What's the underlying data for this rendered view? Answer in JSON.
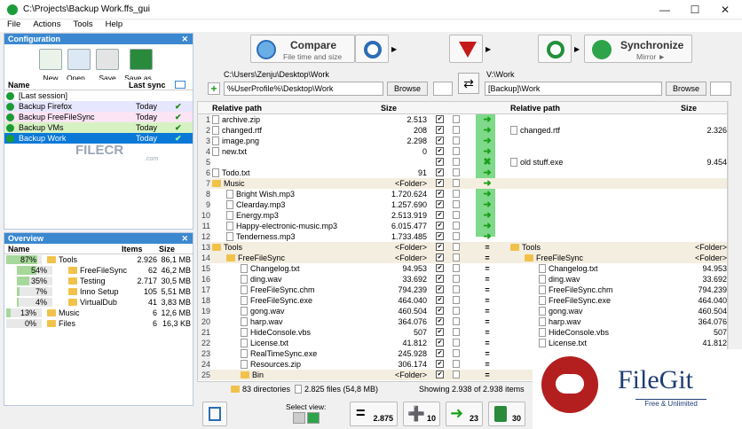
{
  "window": {
    "title": "C:\\Projects\\Backup Work.ffs_gui",
    "min": "—",
    "max": "☐",
    "close": "✕"
  },
  "menu": [
    "File",
    "Actions",
    "Tools",
    "Help"
  ],
  "config": {
    "title": "Configuration",
    "buttons": [
      "New",
      "Open...",
      "Save",
      "Save as..."
    ],
    "col_name": "Name",
    "col_sync": "Last sync",
    "sessions": [
      {
        "name": "[Last session]",
        "date": ""
      },
      {
        "name": "Backup Firefox",
        "date": "Today"
      },
      {
        "name": "Backup FreeFileSync",
        "date": "Today"
      },
      {
        "name": "Backup VMs",
        "date": "Today"
      },
      {
        "name": "Backup Work",
        "date": "Today"
      }
    ]
  },
  "overview": {
    "title": "Overview",
    "col_name": "Name",
    "col_items": "Items",
    "col_size": "Size",
    "rows": [
      {
        "pct": "87%",
        "pctv": 0.87,
        "name": "Tools",
        "items": "2.926",
        "size": "86,1 MB",
        "indent": 0
      },
      {
        "pct": "54%",
        "pctv": 0.54,
        "name": "FreeFileSync",
        "items": "62",
        "size": "46,2 MB",
        "indent": 1
      },
      {
        "pct": "35%",
        "pctv": 0.35,
        "name": "Testing",
        "items": "2.717",
        "size": "30,5 MB",
        "indent": 1
      },
      {
        "pct": "7%",
        "pctv": 0.07,
        "name": "Inno Setup",
        "items": "105",
        "size": "5,51 MB",
        "indent": 1
      },
      {
        "pct": "4%",
        "pctv": 0.04,
        "name": "VirtualDub",
        "items": "41",
        "size": "3,83 MB",
        "indent": 1
      },
      {
        "pct": "13%",
        "pctv": 0.13,
        "name": "Music",
        "items": "6",
        "size": "12,6 MB",
        "indent": 0
      },
      {
        "pct": "0%",
        "pctv": 0.0,
        "name": "Files",
        "items": "6",
        "size": "16,3 KB",
        "indent": 0
      }
    ]
  },
  "toolbar": {
    "compare": "Compare",
    "compare_sub": "File time and size",
    "sync": "Synchronize",
    "sync_sub": "Mirror ►"
  },
  "paths": {
    "left_label": "C:\\Users\\Zenju\\Desktop\\Work",
    "left_value": "%UserProfile%\\Desktop\\Work",
    "right_label": "V:\\Work",
    "right_value": "[Backup]\\Work",
    "browse": "Browse"
  },
  "grid": {
    "col_path": "Relative path",
    "col_size": "Size",
    "left_rows": [
      {
        "n": "1",
        "name": "archive.zip",
        "size": "2.513",
        "indent": 0,
        "folder": false,
        "act": "sync"
      },
      {
        "n": "2",
        "name": "changed.rtf",
        "size": "208",
        "indent": 0,
        "folder": false,
        "act": "sync"
      },
      {
        "n": "3",
        "name": "image.png",
        "size": "2.298",
        "indent": 0,
        "folder": false,
        "act": "sync"
      },
      {
        "n": "4",
        "name": "new.txt",
        "size": "0",
        "indent": 0,
        "folder": false,
        "act": "sync"
      },
      {
        "n": "5",
        "name": "",
        "size": "",
        "indent": 0,
        "folder": false,
        "act": "del"
      },
      {
        "n": "6",
        "name": "Todo.txt",
        "size": "91",
        "indent": 0,
        "folder": false,
        "act": "sync"
      },
      {
        "n": "7",
        "name": "Music",
        "size": "<Folder>",
        "indent": 0,
        "folder": true,
        "act": "sync"
      },
      {
        "n": "8",
        "name": "Bright Wish.mp3",
        "size": "1.720.624",
        "indent": 1,
        "folder": false,
        "act": "sync"
      },
      {
        "n": "9",
        "name": "Clearday.mp3",
        "size": "1.257.690",
        "indent": 1,
        "folder": false,
        "act": "sync"
      },
      {
        "n": "10",
        "name": "Energy.mp3",
        "size": "2.513.919",
        "indent": 1,
        "folder": false,
        "act": "sync"
      },
      {
        "n": "11",
        "name": "Happy-electronic-music.mp3",
        "size": "6.015.477",
        "indent": 1,
        "folder": false,
        "act": "sync"
      },
      {
        "n": "12",
        "name": "Tenderness.mp3",
        "size": "1.733.485",
        "indent": 1,
        "folder": false,
        "act": "sync"
      },
      {
        "n": "13",
        "name": "Tools",
        "size": "<Folder>",
        "indent": 0,
        "folder": true,
        "act": "eq"
      },
      {
        "n": "14",
        "name": "FreeFileSync",
        "size": "<Folder>",
        "indent": 1,
        "folder": true,
        "act": "eq"
      },
      {
        "n": "15",
        "name": "Changelog.txt",
        "size": "94.953",
        "indent": 2,
        "folder": false,
        "act": "eq"
      },
      {
        "n": "16",
        "name": "ding.wav",
        "size": "33.692",
        "indent": 2,
        "folder": false,
        "act": "eq"
      },
      {
        "n": "17",
        "name": "FreeFileSync.chm",
        "size": "794.239",
        "indent": 2,
        "folder": false,
        "act": "eq"
      },
      {
        "n": "18",
        "name": "FreeFileSync.exe",
        "size": "464.040",
        "indent": 2,
        "folder": false,
        "act": "eq"
      },
      {
        "n": "19",
        "name": "gong.wav",
        "size": "460.504",
        "indent": 2,
        "folder": false,
        "act": "eq"
      },
      {
        "n": "20",
        "name": "harp.wav",
        "size": "364.076",
        "indent": 2,
        "folder": false,
        "act": "eq"
      },
      {
        "n": "21",
        "name": "HideConsole.vbs",
        "size": "507",
        "indent": 2,
        "folder": false,
        "act": "eq"
      },
      {
        "n": "22",
        "name": "License.txt",
        "size": "41.812",
        "indent": 2,
        "folder": false,
        "act": "eq"
      },
      {
        "n": "23",
        "name": "RealTimeSync.exe",
        "size": "245.928",
        "indent": 2,
        "folder": false,
        "act": "eq"
      },
      {
        "n": "24",
        "name": "Resources.zip",
        "size": "306.174",
        "indent": 2,
        "folder": false,
        "act": "eq"
      },
      {
        "n": "25",
        "name": "Bin",
        "size": "<Folder>",
        "indent": 2,
        "folder": true,
        "act": "eq"
      }
    ],
    "right_rows": [
      {
        "name": "",
        "size": "",
        "indent": 0,
        "folder": false
      },
      {
        "name": "changed.rtf",
        "size": "2.326",
        "indent": 0,
        "folder": false
      },
      {
        "name": "",
        "size": "",
        "indent": 0,
        "folder": false
      },
      {
        "name": "",
        "size": "",
        "indent": 0,
        "folder": false
      },
      {
        "name": "old stuff.exe",
        "size": "9.454",
        "indent": 0,
        "folder": false
      },
      {
        "name": "",
        "size": "",
        "indent": 0,
        "folder": false
      },
      {
        "name": "",
        "size": "",
        "indent": 0,
        "folder": false
      },
      {
        "name": "",
        "size": "",
        "indent": 0,
        "folder": false
      },
      {
        "name": "",
        "size": "",
        "indent": 0,
        "folder": false
      },
      {
        "name": "",
        "size": "",
        "indent": 0,
        "folder": false
      },
      {
        "name": "",
        "size": "",
        "indent": 0,
        "folder": false
      },
      {
        "name": "",
        "size": "",
        "indent": 0,
        "folder": false
      },
      {
        "name": "Tools",
        "size": "<Folder>",
        "indent": 0,
        "folder": true
      },
      {
        "name": "FreeFileSync",
        "size": "<Folder>",
        "indent": 1,
        "folder": true
      },
      {
        "name": "Changelog.txt",
        "size": "94.953",
        "indent": 2,
        "folder": false
      },
      {
        "name": "ding.wav",
        "size": "33.692",
        "indent": 2,
        "folder": false
      },
      {
        "name": "FreeFileSync.chm",
        "size": "794.239",
        "indent": 2,
        "folder": false
      },
      {
        "name": "FreeFileSync.exe",
        "size": "464.040",
        "indent": 2,
        "folder": false
      },
      {
        "name": "gong.wav",
        "size": "460.504",
        "indent": 2,
        "folder": false
      },
      {
        "name": "harp.wav",
        "size": "364.076",
        "indent": 2,
        "folder": false
      },
      {
        "name": "HideConsole.vbs",
        "size": "507",
        "indent": 2,
        "folder": false
      },
      {
        "name": "License.txt",
        "size": "41.812",
        "indent": 2,
        "folder": false
      }
    ]
  },
  "status": {
    "dirs": "83 directories",
    "files": "2.825 files (54,8 MB)",
    "showing": "Showing 2.938 of 2.938 items"
  },
  "bottom": {
    "select_view": "Select view:",
    "equal": "2.875",
    "create": "10",
    "update": "23",
    "delete": "30"
  },
  "watermarks": {
    "filecr": "FILECR",
    "filecr_sub": ".com",
    "filegit": "FileGit",
    "filegit_tag": "Free & Unlimited"
  },
  "colors": {
    "accent": "#3b88d0",
    "sync_green": "#1aa01a",
    "folder_row": "#f4eee0"
  }
}
